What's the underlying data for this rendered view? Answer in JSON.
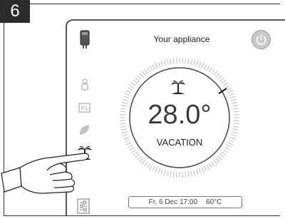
{
  "step": {
    "number": "6"
  },
  "header": {
    "title": "Your appliance"
  },
  "sidebar": {
    "icons": [
      "appliance-icon",
      "manual-icon",
      "p1-program-icon",
      "eco-leaf-icon",
      "vacation-icon",
      "settings-icon"
    ]
  },
  "dial": {
    "temperature": "28.0°",
    "mode": "VACATION",
    "mode_icon": "palm-island-icon"
  },
  "status": {
    "datetime": "Fr, 6 Dec 17:00",
    "water_temp": "60°C"
  },
  "colors": {
    "power_button": "#c9c9c9",
    "dial_ticks": "#bcbcbc",
    "text": "#3a3a3a"
  }
}
